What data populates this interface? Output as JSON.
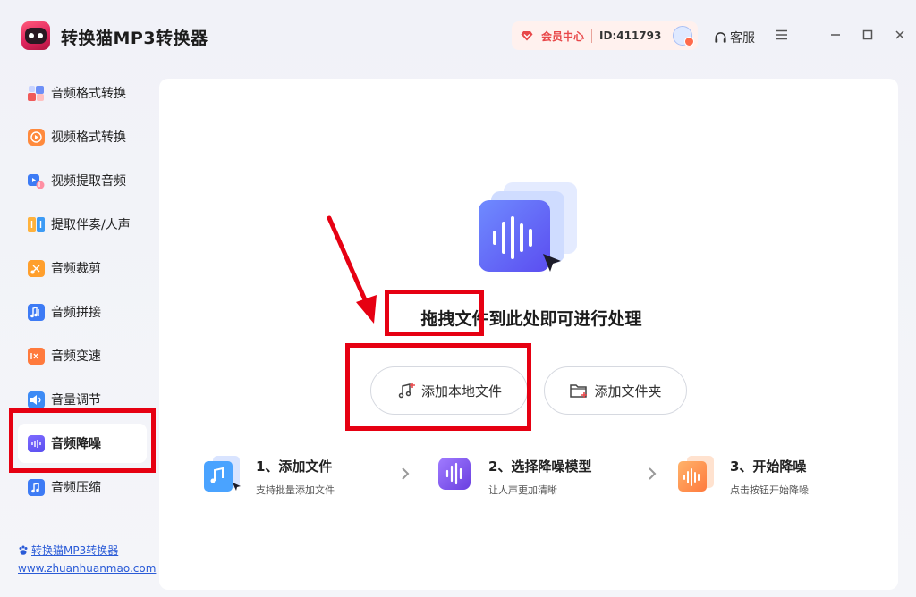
{
  "app": {
    "title": "转换猫MP3转换器",
    "logo_icon": "cat-logo-icon"
  },
  "header": {
    "vip_label": "会员中心",
    "user_id": "ID:411793",
    "service_label": "客服",
    "icons": [
      "diamond-icon",
      "user-avatar-icon",
      "headset-icon",
      "menu-icon",
      "minimize-icon",
      "maximize-icon",
      "close-icon"
    ],
    "accent_color": "#e8484a"
  },
  "sidebar": {
    "items": [
      {
        "label": "音频格式转换",
        "icon": "audio-format-icon",
        "color": "#f05a5a"
      },
      {
        "label": "视频格式转换",
        "icon": "video-format-icon",
        "color": "#ff8a3d"
      },
      {
        "label": "视频提取音频",
        "icon": "extract-audio-icon",
        "color": "#3d7bf5"
      },
      {
        "label": "提取伴奏/人声",
        "icon": "vocal-split-icon",
        "color": "#3d9bf5"
      },
      {
        "label": "音频裁剪",
        "icon": "audio-cut-icon",
        "color": "#ff9f2d"
      },
      {
        "label": "音频拼接",
        "icon": "audio-join-icon",
        "color": "#3d7bf5"
      },
      {
        "label": "音频变速",
        "icon": "speed-icon",
        "color": "#ff7a3d"
      },
      {
        "label": "音量调节",
        "icon": "volume-icon",
        "color": "#3d8bf5"
      },
      {
        "label": "音频降噪",
        "icon": "denoise-icon",
        "color": "#6a5cf5",
        "active": true
      },
      {
        "label": "音频压缩",
        "icon": "compress-icon",
        "color": "#3d7bf5"
      }
    ],
    "footer": {
      "brand_link": "转换猫MP3转换器",
      "website": "www.zhuanhuanmao.com"
    }
  },
  "main": {
    "drop_text": "拖拽文件到此处即可进行处理",
    "buttons": {
      "add_file": "添加本地文件",
      "add_folder": "添加文件夹"
    },
    "steps": [
      {
        "title": "1、添加文件",
        "desc": "支持批量添加文件",
        "icon": "add-file-step-icon"
      },
      {
        "title": "2、选择降噪模型",
        "desc": "让人声更加清晰",
        "icon": "denoise-model-step-icon"
      },
      {
        "title": "3、开始降噪",
        "desc": "点击按钮开始降噪",
        "icon": "start-denoise-step-icon"
      }
    ]
  },
  "annotation": {
    "color": "#e60012"
  }
}
